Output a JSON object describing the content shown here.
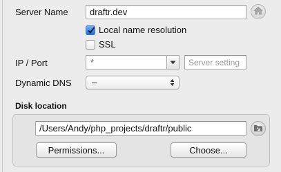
{
  "server": {
    "name_label": "Server Name",
    "name_value": "draftr.dev"
  },
  "options": {
    "local_resolution_label": "Local name resolution",
    "local_resolution_checked": true,
    "ssl_label": "SSL",
    "ssl_checked": false
  },
  "network": {
    "ip_port_label": "IP / Port",
    "ip_value": "*",
    "port_placeholder": "Server setting",
    "dynamic_dns_label": "Dynamic DNS",
    "dynamic_dns_value": "–"
  },
  "disk": {
    "section_title": "Disk location",
    "path_value": "/Users/Andy/php_projects/draftr/public",
    "permissions_label": "Permissions...",
    "choose_label": "Choose..."
  },
  "icons": {
    "home": "home-icon",
    "folder_reveal": "folder-reveal-icon",
    "checkmark": "checkmark-icon",
    "combo_arrow": "chevron-down-icon",
    "popup_arrows": "up-down-arrows-icon"
  }
}
